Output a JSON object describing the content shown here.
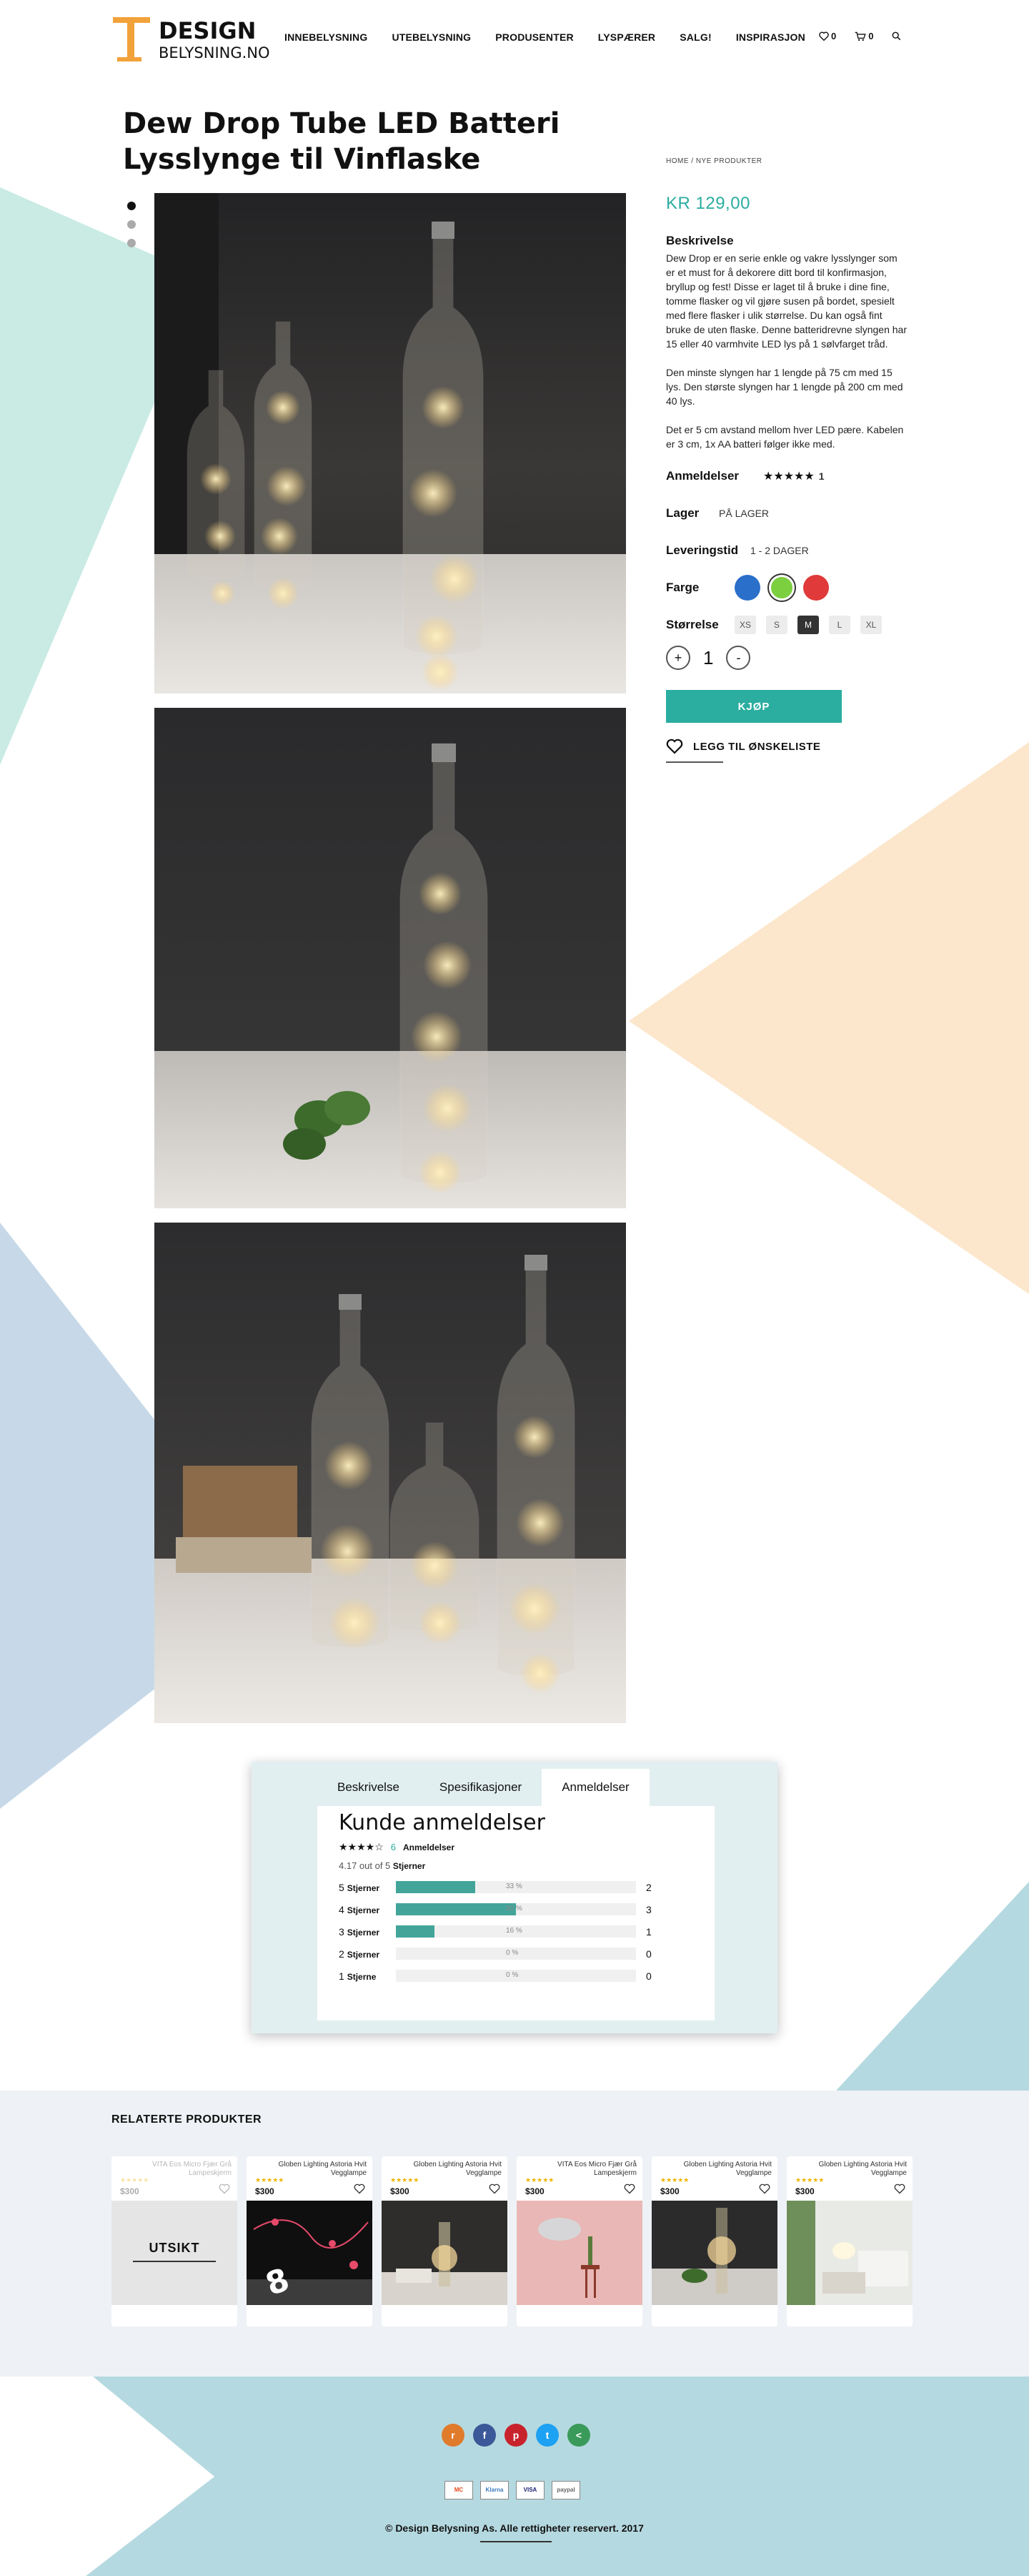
{
  "brand": {
    "line1": "DESIGN",
    "line2": "BELYSNING.NO"
  },
  "nav": [
    "INNEBELYSNING",
    "UTEBELYSNING",
    "PRODUSENTER",
    "LYSPÆRER",
    "SALG!",
    "INSPIRASJON"
  ],
  "header_icons": {
    "wishlist_count": "0",
    "cart_count": "0",
    "icons": [
      "heart-icon",
      "cart-icon",
      "search-icon"
    ]
  },
  "product": {
    "title": "Dew Drop Tube LED Batteri Lysslynge til Vinflaske",
    "breadcrumb": "HOME / NYE PRODUKTER",
    "price": "KR 129,00",
    "desc_heading": "Beskrivelse",
    "desc": [
      "Dew Drop er en serie enkle og vakre lysslynger som er et must for å dekorere ditt bord til konfirmasjon, bryllup og fest! Disse er laget til å bruke i dine fine, tomme flasker og vil gjøre susen på bordet, spesielt med flere flasker i ulik størrelse. Du kan også fint bruke de uten flaske. Denne batteridrevne slyngen har 15 eller 40 varmhvite LED lys på 1 sølvfarget tråd.",
      "Den minste slyngen har 1 lengde på 75 cm med 15 lys. Den største slyngen har 1 lengde på 200 cm med 40 lys.",
      "Det er 5 cm avstand mellom hver LED pære. Kabelen er 3 cm, 1x AA batteri følger ikke med."
    ],
    "reviews_label": "Anmeldelser",
    "reviews_stars": "★★★★★",
    "reviews_count": "1",
    "stock_label": "Lager",
    "stock_value": "PÅ LAGER",
    "delivery_label": "Leveringstid",
    "delivery_value": "1 - 2 DAGER",
    "color_label": "Farge",
    "colors": [
      "#2a6fc9",
      "#7ccf3f",
      "#e03a3a"
    ],
    "size_label": "Størrelse",
    "sizes": [
      "XS",
      "S",
      "M",
      "L",
      "XL"
    ],
    "size_selected": "M",
    "qty_plus": "+",
    "qty": "1",
    "qty_minus": "-",
    "buy": "KJØP",
    "wishlist": "LEGG TIL ØNSKELISTE"
  },
  "review_card": {
    "tabs": [
      "Beskrivelse",
      "Spesifikasjoner",
      "Anmeldelser"
    ],
    "active_tab": "Anmeldelser",
    "title": "Kunde anmeldelser",
    "stars": "★★★★☆",
    "count": "6",
    "count_label": "Anmeldelser",
    "average": "4.17 out of 5",
    "average_label": "Stjerner",
    "rows": [
      {
        "stars": "5",
        "label": "Stjerner",
        "pct": 33,
        "pct_text": "33 %",
        "count": "2"
      },
      {
        "stars": "4",
        "label": "Stjerner",
        "pct": 50,
        "pct_text": "50 %",
        "count": "3"
      },
      {
        "stars": "3",
        "label": "Stjerner",
        "pct": 16,
        "pct_text": "16 %",
        "count": "1"
      },
      {
        "stars": "2",
        "label": "Stjerner",
        "pct": 0,
        "pct_text": "0 %",
        "count": "0"
      },
      {
        "stars": "1",
        "label": "Stjerne",
        "pct": 0,
        "pct_text": "0 %",
        "count": "0"
      }
    ]
  },
  "related": {
    "heading": "RELATERTE PRODUKTER",
    "out_label": "UTSIKT",
    "items": [
      {
        "name": "VITA Eos Micro Fjær Grå Lampeskjerm",
        "stars": "★★★★★",
        "price": "$300",
        "out": true,
        "image": "out"
      },
      {
        "name": "Globen Lighting Astoria Hvit Vegglampe",
        "stars": "★★★★★",
        "price": "$300",
        "out": false,
        "image": "dark-party"
      },
      {
        "name": "Globen Lighting Astoria Hvit Vegglampe",
        "stars": "★★★★★",
        "price": "$300",
        "out": false,
        "image": "bottle-table"
      },
      {
        "name": "VITA Eos Micro Fjær Grå Lampeskjerm",
        "stars": "★★★★★",
        "price": "$300",
        "out": false,
        "image": "pink-room"
      },
      {
        "name": "Globen Lighting Astoria Hvit Vegglampe",
        "stars": "★★★★★",
        "price": "$300",
        "out": false,
        "image": "bottle-dark"
      },
      {
        "name": "Globen Lighting Astoria Hvit Vegglampe",
        "stars": "★★★★★",
        "price": "$300",
        "out": false,
        "image": "living-room"
      }
    ]
  },
  "footer": {
    "social": [
      {
        "icon": "rss-icon",
        "glyph": "r",
        "color": "#e07b2c"
      },
      {
        "icon": "facebook-icon",
        "glyph": "f",
        "color": "#3b5998"
      },
      {
        "icon": "pinterest-icon",
        "glyph": "p",
        "color": "#c8232c"
      },
      {
        "icon": "twitter-icon",
        "glyph": "t",
        "color": "#1da1f2"
      },
      {
        "icon": "share-icon",
        "glyph": "<",
        "color": "#3a9a5a"
      }
    ],
    "payments": [
      "MC",
      "Klarna",
      "VISA",
      "paypal"
    ],
    "copyright": "© Design Belysning As. Alle rettigheter reservert. 2017"
  },
  "colors": {
    "accent": "#2bada0",
    "bar": "#43a59a",
    "mint": "#c9ebe4",
    "peach": "#fce7cc",
    "blue": "#c7d9e8",
    "footer_blue": "#b5d9e0"
  }
}
